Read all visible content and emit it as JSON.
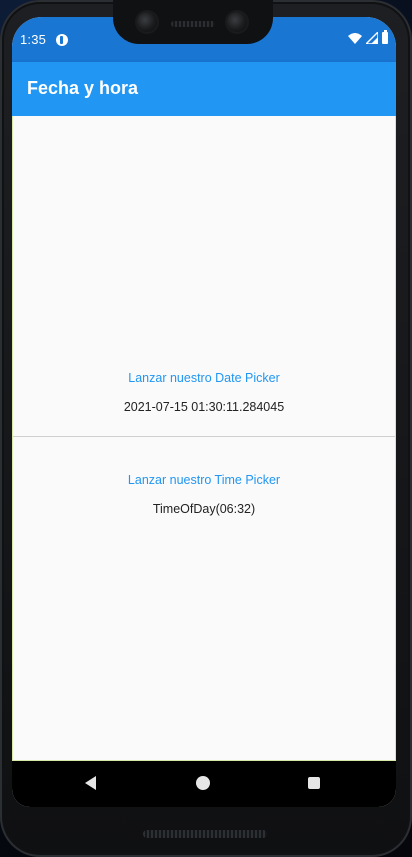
{
  "status_bar": {
    "time": "1:35",
    "icons": [
      "app-notification-icon",
      "wifi-icon",
      "signal-icon",
      "battery-icon"
    ]
  },
  "app_bar": {
    "title": "Fecha y hora"
  },
  "date_section": {
    "button_label": "Lanzar nuestro Date Picker",
    "value": "2021-07-15 01:30:11.284045"
  },
  "time_section": {
    "button_label": "Lanzar nuestro Time Picker",
    "value": "TimeOfDay(06:32)"
  },
  "nav_bar": {
    "icons": [
      "back-icon",
      "home-icon",
      "recents-icon"
    ]
  },
  "colors": {
    "status_bar": "#1976d2",
    "app_bar": "#2196f3",
    "link": "#2196f3",
    "background": "#fafafa"
  }
}
